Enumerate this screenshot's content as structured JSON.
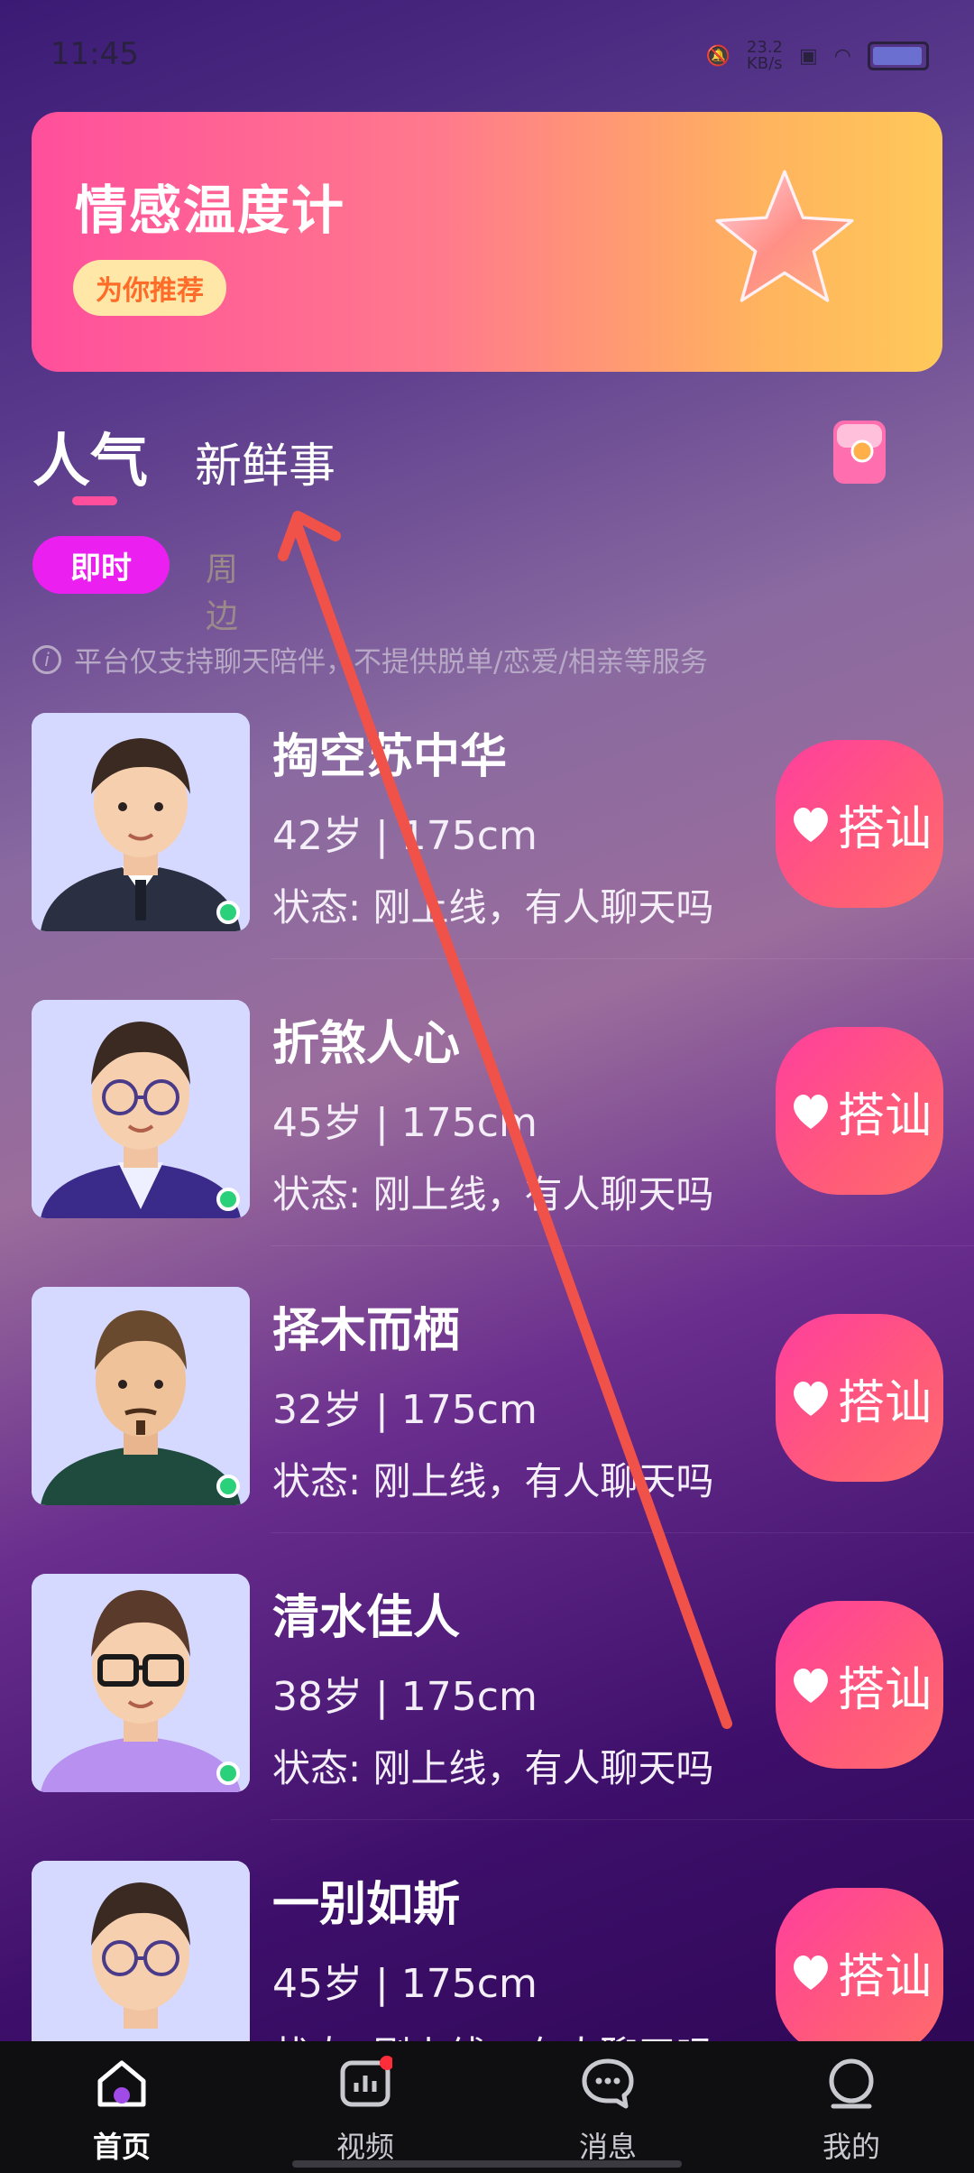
{
  "status_bar": {
    "time": "11:45",
    "net_speed": "23.2\nKB/s"
  },
  "banner": {
    "title": "情感温度计",
    "tag": "为你推荐"
  },
  "tabs": {
    "main": "人气",
    "secondary": "新鲜事"
  },
  "filters": {
    "active": "即时",
    "inactive": "周边"
  },
  "notice": "平台仅支持聊天陪伴，不提供脱单/恋爱/相亲等服务",
  "users": [
    {
      "name": "掏空苏中华",
      "meta": "42岁 | 175cm",
      "status": "状态: 刚上线，有人聊天吗",
      "button": "搭讪"
    },
    {
      "name": "折煞人心",
      "meta": "45岁 | 175cm",
      "status": "状态: 刚上线，有人聊天吗",
      "button": "搭讪"
    },
    {
      "name": "择木而栖",
      "meta": "32岁 | 175cm",
      "status": "状态: 刚上线，有人聊天吗",
      "button": "搭讪"
    },
    {
      "name": "清水佳人",
      "meta": "38岁 | 175cm",
      "status": "状态: 刚上线，有人聊天吗",
      "button": "搭讪"
    },
    {
      "name": "一别如斯",
      "meta": "45岁 | 175cm",
      "status": "状态: 刚上线，有人聊天吗",
      "button": "搭讪"
    }
  ],
  "nav": [
    {
      "label": "首页",
      "icon": "home-icon",
      "active": true
    },
    {
      "label": "视频",
      "icon": "video-chart-icon",
      "badge": true
    },
    {
      "label": "消息",
      "icon": "message-icon"
    },
    {
      "label": "我的",
      "icon": "profile-icon"
    }
  ],
  "colors": {
    "accent": "#ea1ff0",
    "button": "#ff4f8a",
    "online": "#2ad17a"
  }
}
